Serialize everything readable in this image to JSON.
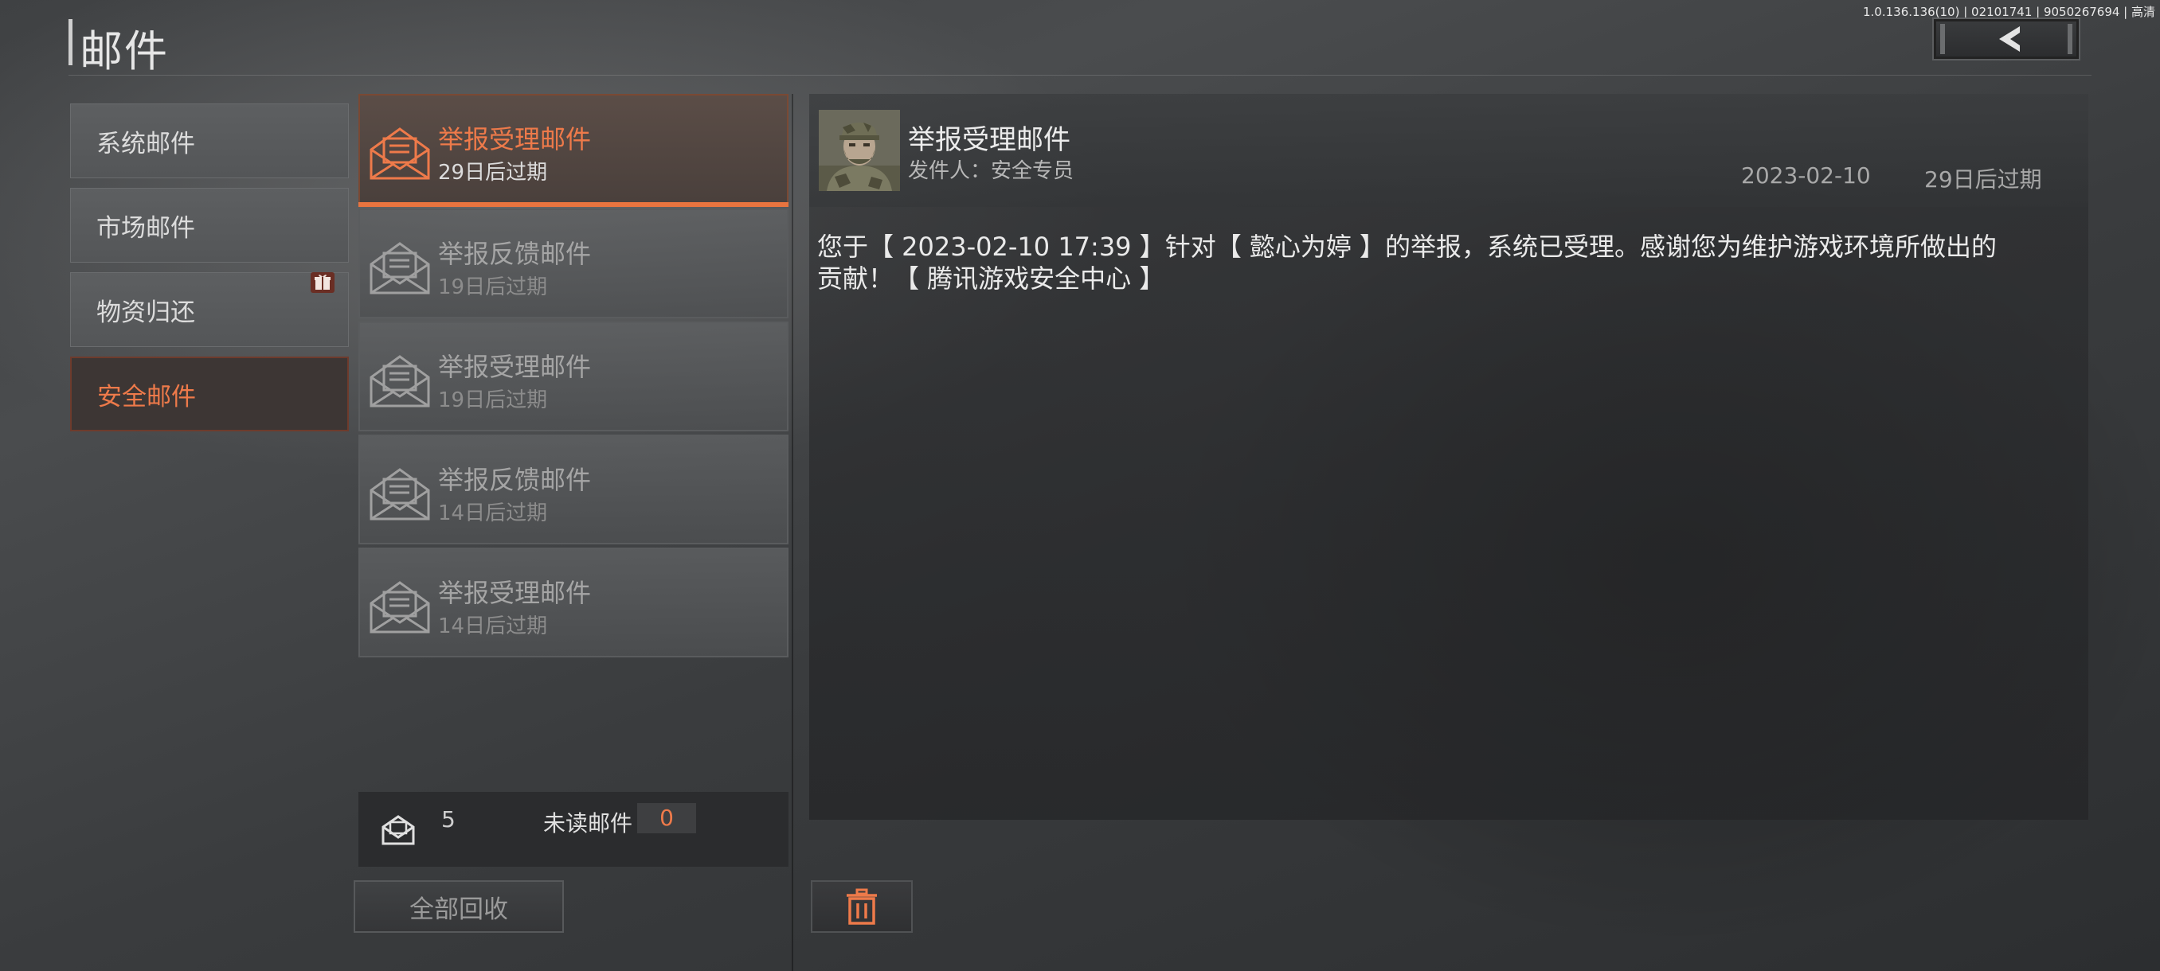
{
  "version": "1.0.136.136(10) | 02101741 | 9050267694 | 高清",
  "header": {
    "title": "邮件"
  },
  "categories": [
    {
      "label": "系统邮件",
      "active": false
    },
    {
      "label": "市场邮件",
      "active": false
    },
    {
      "label": "物资归还",
      "active": false,
      "gift": true
    },
    {
      "label": "安全邮件",
      "active": true
    }
  ],
  "mails": [
    {
      "title": "举报受理邮件",
      "expiry": "29日后过期",
      "active": true
    },
    {
      "title": "举报反馈邮件",
      "expiry": "19日后过期",
      "active": false
    },
    {
      "title": "举报受理邮件",
      "expiry": "19日后过期",
      "active": false
    },
    {
      "title": "举报反馈邮件",
      "expiry": "14日后过期",
      "active": false
    },
    {
      "title": "举报受理邮件",
      "expiry": "14日后过期",
      "active": false
    }
  ],
  "stats": {
    "total": "5",
    "unread_label": "未读邮件",
    "unread_count": "0"
  },
  "collect_all_label": "全部回收",
  "detail": {
    "title": "举报受理邮件",
    "sender_label": "发件人：",
    "sender": "安全专员",
    "date": "2023-02-10",
    "expiry": "29日后过期",
    "body": "您于【 2023-02-10 17:39 】针对【 懿心为婷 】的举报，系统已受理。感谢您为维护游戏环境所做出的贡献！【 腾讯游戏安全中心 】"
  },
  "colors": {
    "accent": "#ee7a4a",
    "accent_bar": "#e8743f"
  },
  "icons": {
    "back": "chevron-left-icon",
    "gift": "gift-icon",
    "mail": "envelope-open-icon",
    "delete": "trash-icon"
  }
}
